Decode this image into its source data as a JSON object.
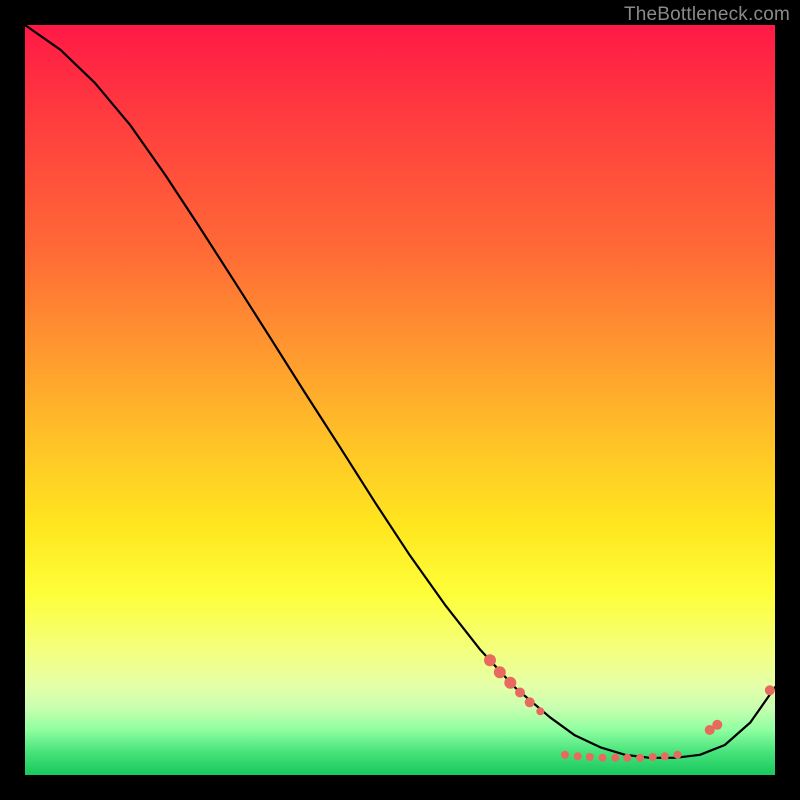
{
  "watermark": "TheBottleneck.com",
  "colors": {
    "dot": "#e86a5e",
    "line": "#000000",
    "background": "#000000"
  },
  "chart_data": {
    "type": "line",
    "title": "",
    "xlabel": "",
    "ylabel": "",
    "xlim": [
      0,
      100
    ],
    "ylim": [
      0,
      100
    ],
    "grid": false,
    "legend": false,
    "note": "Axes are unlabeled; x/y are normalized 0–100 from pixel positions inside the 750×750 plot area (origin bottom-left).",
    "series": [
      {
        "name": "curve",
        "x": [
          0.0,
          4.7,
          9.3,
          14.0,
          18.7,
          23.3,
          28.0,
          32.7,
          37.3,
          42.0,
          46.7,
          51.3,
          56.0,
          60.7,
          65.3,
          70.0,
          73.3,
          76.7,
          80.0,
          83.3,
          86.7,
          90.0,
          93.3,
          96.7,
          100.0
        ],
        "y": [
          100.0,
          96.7,
          92.3,
          86.7,
          80.0,
          73.0,
          65.7,
          58.3,
          51.0,
          43.7,
          36.3,
          29.3,
          22.7,
          16.7,
          11.7,
          7.7,
          5.3,
          3.7,
          2.7,
          2.3,
          2.3,
          2.7,
          4.0,
          7.0,
          11.7
        ]
      }
    ],
    "markers": {
      "name": "highlighted-points",
      "color": "#e86a5e",
      "points": [
        {
          "x": 62.0,
          "y": 15.3,
          "r": 6
        },
        {
          "x": 63.3,
          "y": 13.7,
          "r": 6
        },
        {
          "x": 64.7,
          "y": 12.3,
          "r": 6
        },
        {
          "x": 66.0,
          "y": 11.0,
          "r": 5
        },
        {
          "x": 67.3,
          "y": 9.7,
          "r": 5
        },
        {
          "x": 68.7,
          "y": 8.5,
          "r": 4
        },
        {
          "x": 72.0,
          "y": 2.7,
          "r": 4
        },
        {
          "x": 73.7,
          "y": 2.5,
          "r": 4
        },
        {
          "x": 75.3,
          "y": 2.4,
          "r": 4
        },
        {
          "x": 77.0,
          "y": 2.3,
          "r": 4
        },
        {
          "x": 78.7,
          "y": 2.3,
          "r": 4
        },
        {
          "x": 80.3,
          "y": 2.3,
          "r": 4
        },
        {
          "x": 82.0,
          "y": 2.3,
          "r": 4
        },
        {
          "x": 83.7,
          "y": 2.4,
          "r": 4
        },
        {
          "x": 85.3,
          "y": 2.5,
          "r": 4
        },
        {
          "x": 87.0,
          "y": 2.7,
          "r": 4
        },
        {
          "x": 91.3,
          "y": 6.0,
          "r": 5
        },
        {
          "x": 92.3,
          "y": 6.7,
          "r": 5
        },
        {
          "x": 99.3,
          "y": 11.3,
          "r": 5
        }
      ]
    }
  }
}
